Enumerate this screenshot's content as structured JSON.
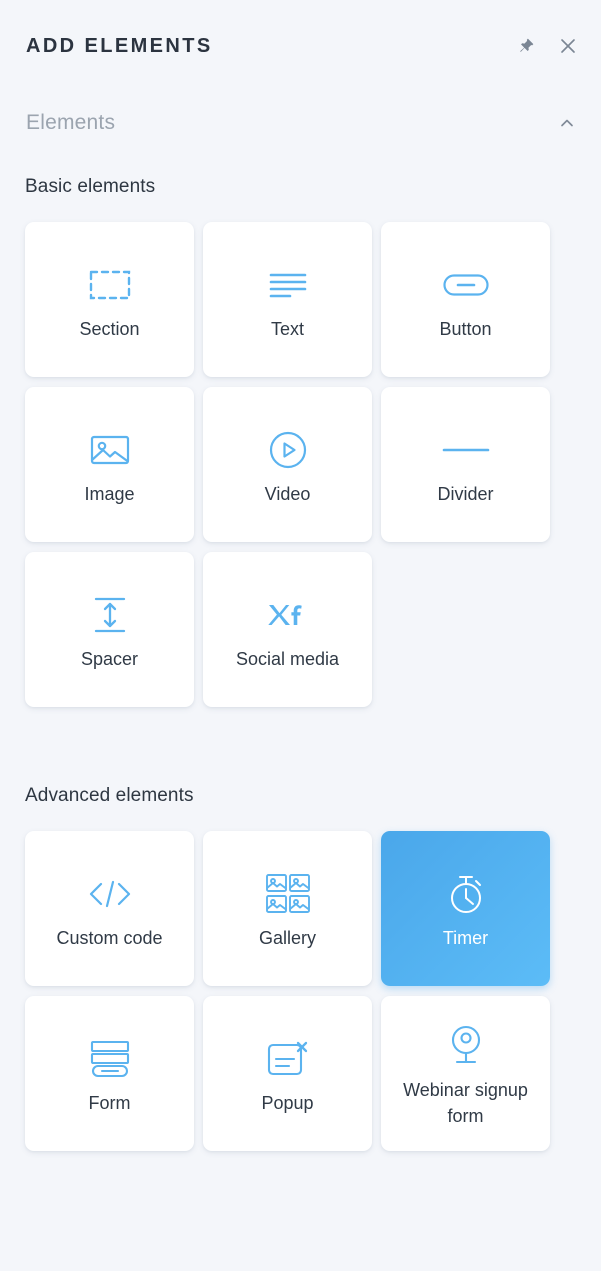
{
  "header": {
    "title": "ADD ELEMENTS",
    "pin_icon": "pin-icon",
    "close_icon": "close-icon"
  },
  "section_bar": {
    "label": "Elements",
    "chevron_icon": "chevron-up-icon",
    "expanded": true
  },
  "groups": [
    {
      "id": "basic",
      "title": "Basic elements",
      "items": [
        {
          "label": "Section",
          "icon": "dashed-rectangle-icon",
          "selected": false
        },
        {
          "label": "Text",
          "icon": "text-lines-icon",
          "selected": false
        },
        {
          "label": "Button",
          "icon": "pill-button-icon",
          "selected": false
        },
        {
          "label": "Image",
          "icon": "picture-icon",
          "selected": false
        },
        {
          "label": "Video",
          "icon": "play-circle-icon",
          "selected": false
        },
        {
          "label": "Divider",
          "icon": "horizontal-line-icon",
          "selected": false
        },
        {
          "label": "Spacer",
          "icon": "vertical-arrow-icon",
          "selected": false
        },
        {
          "label": "Social media",
          "icon": "social-x-facebook-icon",
          "selected": false
        }
      ]
    },
    {
      "id": "advanced",
      "title": "Advanced elements",
      "items": [
        {
          "label": "Custom code",
          "icon": "code-brackets-icon",
          "selected": false
        },
        {
          "label": "Gallery",
          "icon": "image-grid-icon",
          "selected": false
        },
        {
          "label": "Timer",
          "icon": "stopwatch-icon",
          "selected": true
        },
        {
          "label": "Form",
          "icon": "form-fields-icon",
          "selected": false
        },
        {
          "label": "Popup",
          "icon": "popup-window-icon",
          "selected": false
        },
        {
          "label": "Webinar\nsignup form",
          "icon": "webcam-icon",
          "selected": false
        }
      ]
    }
  ],
  "colors": {
    "background": "#f4f6fa",
    "card": "#ffffff",
    "accent": "#5bb3ef",
    "selected_gradient_from": "#4aa7ea",
    "selected_gradient_to": "#5cbcf7",
    "text": "#303a46",
    "muted_text": "#9ba4af"
  }
}
